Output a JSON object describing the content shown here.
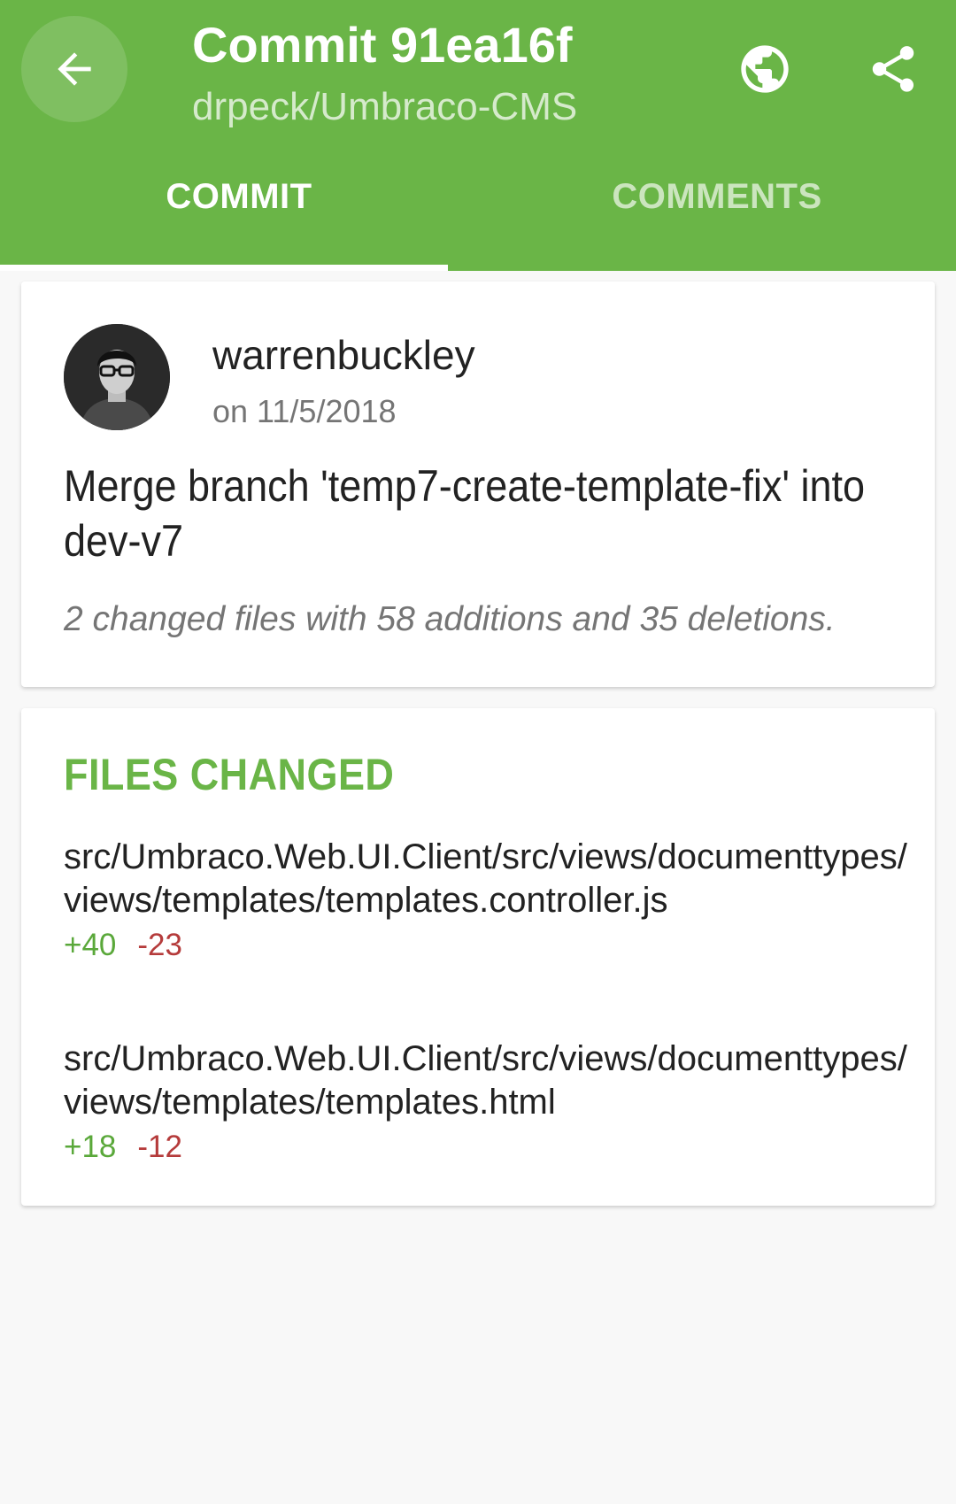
{
  "header": {
    "title": "Commit 91ea16f",
    "subtitle": "drpeck/Umbraco-CMS",
    "back_icon": "arrow-left-icon",
    "globe_icon": "globe-icon",
    "share_icon": "share-icon"
  },
  "tabs": [
    {
      "label": "COMMIT",
      "active": true
    },
    {
      "label": "COMMENTS",
      "active": false
    }
  ],
  "commit": {
    "author": "warrenbuckley",
    "date": "on 11/5/2018",
    "message": "Merge branch 'temp7-create-template-fix' into dev-v7",
    "stats": "2 changed files with 58 additions and 35 deletions."
  },
  "files_changed": {
    "heading": "FILES CHANGED",
    "files": [
      {
        "path": "src/Umbraco.Web.UI.Client/src/views/documenttypes/views/templates/templates.controller.js",
        "additions": "+40",
        "deletions": "-23"
      },
      {
        "path": "src/Umbraco.Web.UI.Client/src/views/documenttypes/views/templates/templates.html",
        "additions": "+18",
        "deletions": "-12"
      }
    ]
  },
  "colors": {
    "primary": "#6ab547",
    "additions": "#5aa83a",
    "deletions": "#b53b3b"
  }
}
